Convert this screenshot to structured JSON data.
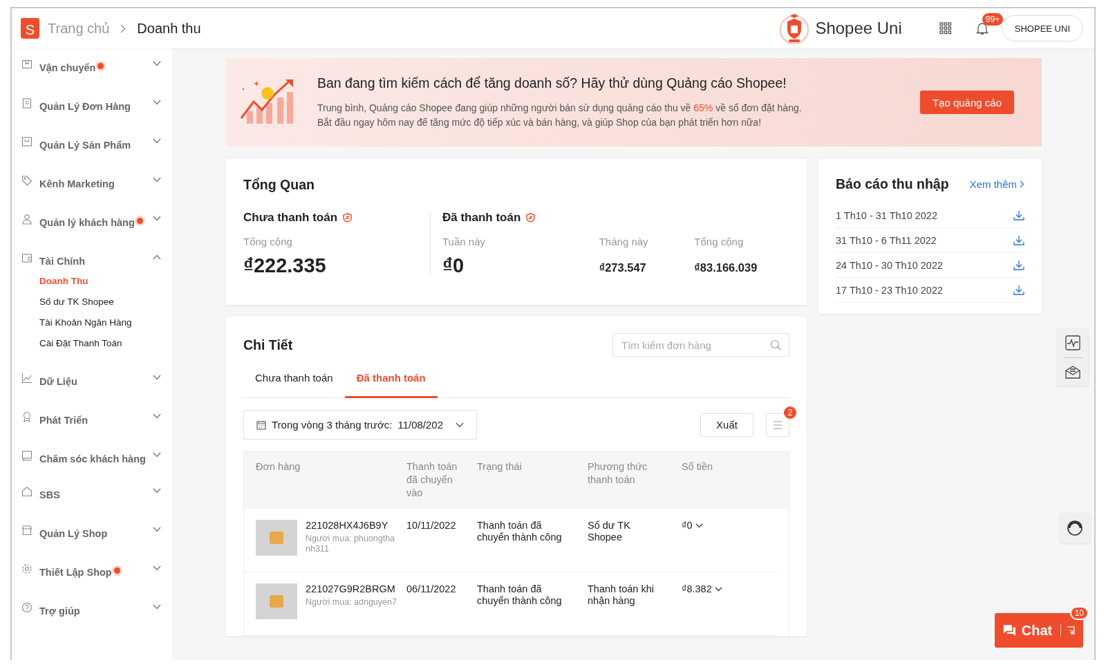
{
  "header": {
    "logo_text": "S",
    "breadcrumb": [
      {
        "label": "Trang chủ",
        "current": false
      },
      {
        "label": "Doanh thu",
        "current": true
      }
    ],
    "brand": "Shopee Uni",
    "notification_badge": "99+",
    "account": "SHOPEE UNI"
  },
  "sidebar": {
    "items": [
      {
        "label": "Vận chuyển",
        "dot": true,
        "expanded": false
      },
      {
        "label": "Quản Lý Đơn Hàng",
        "dot": false,
        "expanded": false
      },
      {
        "label": "Quản Lý Sản Phẩm",
        "dot": false,
        "expanded": false
      },
      {
        "label": "Kênh Marketing",
        "dot": false,
        "expanded": false
      },
      {
        "label": "Quản lý khách hàng",
        "dot": true,
        "expanded": false
      },
      {
        "label": "Tài Chính",
        "dot": false,
        "expanded": true,
        "children": [
          {
            "label": "Doanh Thu",
            "selected": true
          },
          {
            "label": "Số dư TK Shopee",
            "selected": false
          },
          {
            "label": "Tài Khoản Ngân Hàng",
            "selected": false
          },
          {
            "label": "Cài Đặt Thanh Toán",
            "selected": false
          }
        ]
      },
      {
        "label": "Dữ Liệu",
        "dot": false,
        "expanded": false
      },
      {
        "label": "Phát Triển",
        "dot": false,
        "expanded": false
      },
      {
        "label": "Chăm sóc khách hàng",
        "dot": false,
        "expanded": false
      },
      {
        "label": "SBS",
        "dot": false,
        "expanded": false
      },
      {
        "label": "Quản Lý Shop",
        "dot": false,
        "expanded": false
      },
      {
        "label": "Thiết Lập Shop",
        "dot": true,
        "expanded": false
      },
      {
        "label": "Trợ giúp",
        "dot": false,
        "expanded": false
      }
    ]
  },
  "banner": {
    "title": "Ban đang tìm kiếm cách để tăng doanh số? Hãy thử dùng Quảng cáo Shopee!",
    "line1": {
      "before": "Trung bình, Quảng cáo Shopee đang giúp những người bán sử dụng quảng cáo thu về",
      "highlight": "65%",
      "after": "về số đơn đặt hàng."
    },
    "line2": "Bắt đầu ngay hôm nay để tăng mức độ tiếp xúc và bán hàng, và giúp Shop của bạn phát triển hơn nữa!",
    "button": "Tạo quảng cáo"
  },
  "overview": {
    "title": "Tổng Quan",
    "sections": [
      {
        "title": "Chưa thanh toán",
        "stats": [
          {
            "label": "Tổng cộng",
            "value": "₫222.335",
            "kind": "primary"
          }
        ]
      },
      {
        "title": "Đã thanh toán",
        "stats": [
          {
            "label": "Tuần này",
            "value": "₫0",
            "kind": "primary"
          },
          {
            "label": "Tháng này",
            "value": "₫273.547",
            "kind": "secondary"
          },
          {
            "label": "Tổng cộng",
            "value": "₫83.166.039",
            "kind": "secondary"
          }
        ]
      }
    ]
  },
  "reports": {
    "title": "Báo cáo thu nhập",
    "link": "Xem thêm",
    "items": [
      "1 Th10 - 31 Th10 2022",
      "31 Th10 - 6 Th11 2022",
      "24 Th10 - 30 Th10 2022",
      "17 Th10 - 23 Th10 2022"
    ]
  },
  "details": {
    "title": "Chi Tiết",
    "search": {
      "placeholder": "Tìm kiếm đơn hàng"
    },
    "tabs": [
      {
        "label": "Chưa thanh toán",
        "selected": false
      },
      {
        "label": "Đã thanh toán",
        "selected": true
      }
    ],
    "date_filter": {
      "label": "Trong vòng 3 tháng trước:",
      "value": "11/08/202"
    },
    "export_button": "Xuất",
    "filter_badge": "2",
    "columns": [
      "Đơn hàng",
      "Thanh toán đã chuyển vào",
      "Trạng thái",
      "Phương thức thanh toán",
      "Số tiền"
    ],
    "rows": [
      {
        "order_id": "221028HX4J6B9Y",
        "buyer": "Người mua: phuongthanh311",
        "date": "10/11/2022",
        "status": "Thanh toán đã chuyển thành công",
        "method": "Số dư TK Shopee",
        "amount": "₫0"
      },
      {
        "order_id": "221027G9R2BRGM",
        "buyer": "Người mua: adnguyen7",
        "date": "06/11/2022",
        "status": "Thanh toán đã chuyển thành công",
        "method": "Thanh toán khi nhận hàng",
        "amount": "₫8.382"
      }
    ]
  },
  "chat": {
    "label": "Chat",
    "badge": "10"
  }
}
